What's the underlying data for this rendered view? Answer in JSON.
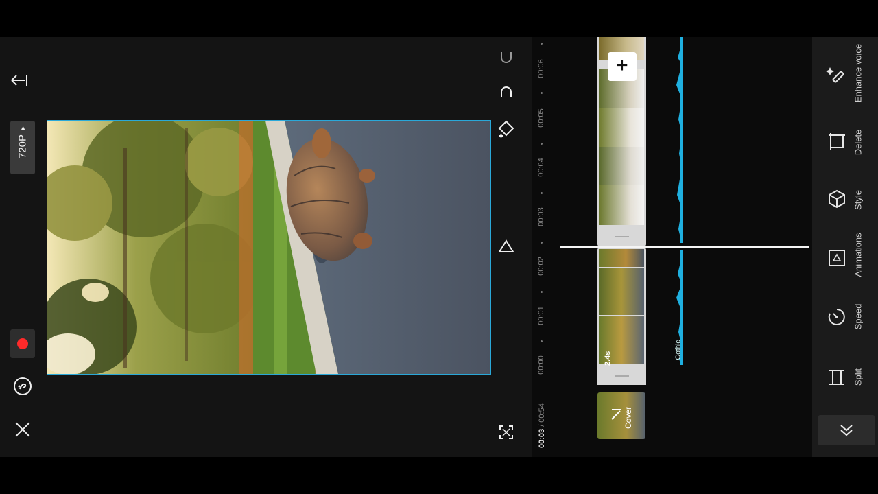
{
  "left_panel": {
    "back_icon": "arrow-left-icon",
    "resolution_label": "720P",
    "resolution_arrow": "▸",
    "record_icon": "record-icon",
    "help_icon": "help-icon",
    "close_icon": "close-icon"
  },
  "preview": {
    "scene": "turtle-on-road-image"
  },
  "controls": {
    "undo_icon": "undo-icon",
    "redo_icon": "redo-icon",
    "keyframe_icon": "keyframe-icon",
    "play_icon": "play-icon",
    "fullscreen_icon": "fullscreen-icon"
  },
  "timeline": {
    "time_current": "00:03",
    "time_total": " / 00:54",
    "ruler": [
      "00:00",
      "00:01",
      "00:02",
      "00:03",
      "00:04",
      "00:05",
      "00:06"
    ],
    "clip_duration": "2.4s",
    "audio_label": "Gothic",
    "add_label": "+",
    "cover_label": "Cover",
    "colors": {
      "accent": "#2aa8d8",
      "audio": "#1fb0e0",
      "record": "#ff2a2a"
    }
  },
  "tools": [
    {
      "name": "tool-enhance-voice",
      "label": "Enhance voice",
      "icon": "enhance-voice-icon"
    },
    {
      "name": "tool-delete",
      "label": "Delete",
      "icon": "delete-icon"
    },
    {
      "name": "tool-style",
      "label": "Style",
      "icon": "style-icon"
    },
    {
      "name": "tool-animations",
      "label": "Animations",
      "icon": "animations-icon"
    },
    {
      "name": "tool-speed",
      "label": "Speed",
      "icon": "speed-icon"
    },
    {
      "name": "tool-split",
      "label": "Split",
      "icon": "split-icon"
    }
  ],
  "collapse_icon": "double-chevron-down-icon"
}
